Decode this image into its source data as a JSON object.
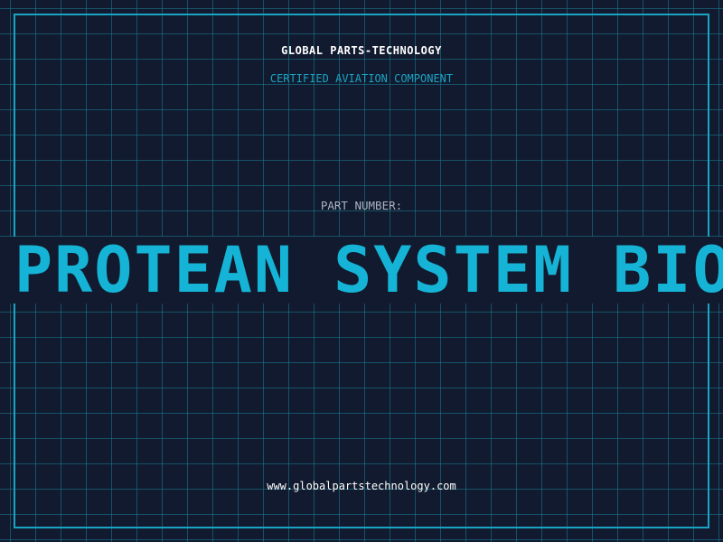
{
  "header": {
    "company": "GLOBAL PARTS-TECHNOLOGY",
    "subtitle": "CERTIFIED AVIATION COMPONENT"
  },
  "part": {
    "label": "PART NUMBER:",
    "value": "PROTEAN SYSTEM BIO"
  },
  "footer": {
    "website": "www.globalpartstechnology.com"
  },
  "colors": {
    "background": "#111a2e",
    "grid": "#198096",
    "accent": "#1aa4c4",
    "part_text": "#15b4d6"
  }
}
